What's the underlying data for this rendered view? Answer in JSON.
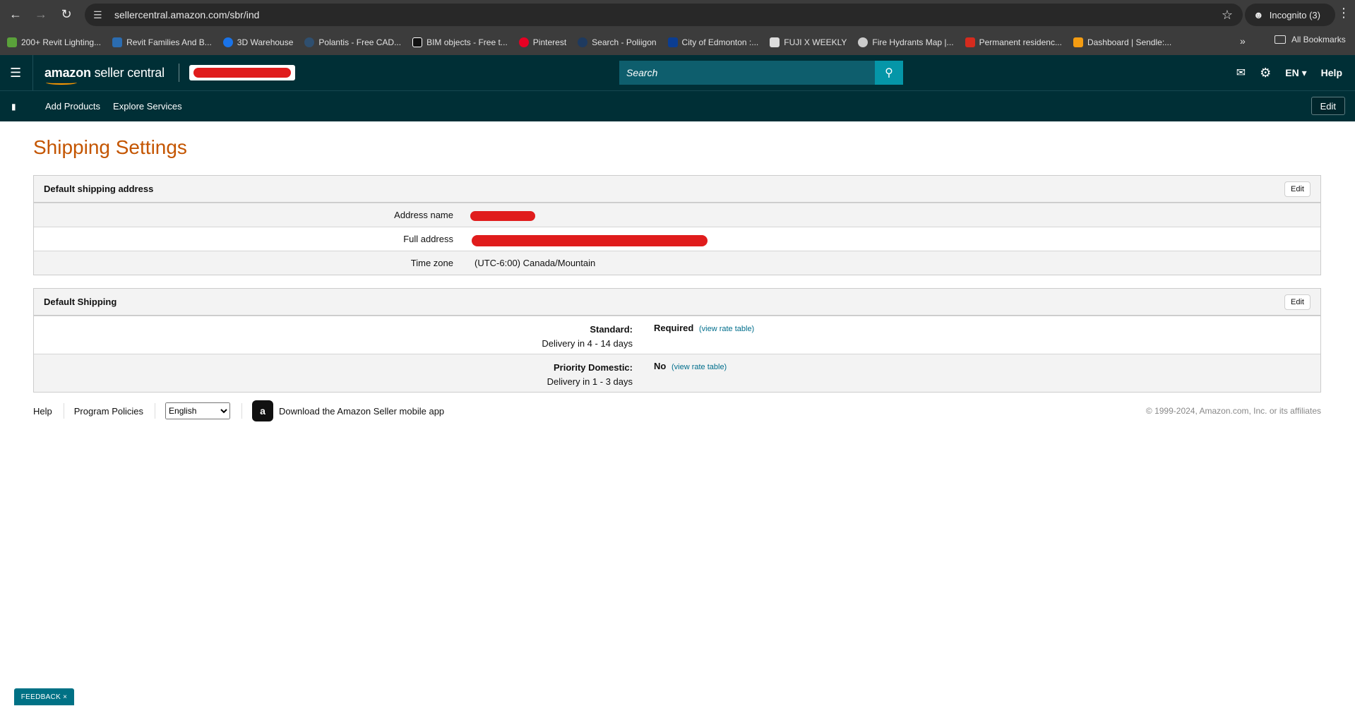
{
  "browser": {
    "url": "sellercentral.amazon.com/sbr/ind",
    "incognito_label": "Incognito (3)",
    "all_bookmarks_label": "All Bookmarks"
  },
  "bookmarks": [
    {
      "label": "200+ Revit Lighting...",
      "color": "#5aa13a"
    },
    {
      "label": "Revit Families And B...",
      "color": "#2b6cb0"
    },
    {
      "label": "3D Warehouse",
      "color": "#1a73e8"
    },
    {
      "label": "Polantis - Free CAD...",
      "color": "#2f4f6f"
    },
    {
      "label": "BIM objects - Free t...",
      "color": "#111111"
    },
    {
      "label": "Pinterest",
      "color": "#e60023"
    },
    {
      "label": "Search - Poliigon",
      "color": "#1e3a5f"
    },
    {
      "label": "City of Edmonton :...",
      "color": "#0b3d91"
    },
    {
      "label": "FUJI X WEEKLY",
      "color": "#dddddd"
    },
    {
      "label": "Fire Hydrants Map |...",
      "color": "#cccccc"
    },
    {
      "label": "Permanent residenc...",
      "color": "#d52b1e"
    },
    {
      "label": "Dashboard | Sendle:...",
      "color": "#f39c12"
    }
  ],
  "header": {
    "logo_bold": "amazon",
    "logo_rest": " seller central",
    "search_placeholder": "Search",
    "lang": "EN",
    "help": "Help"
  },
  "subnav": {
    "links": [
      "Add Products",
      "Explore Services"
    ],
    "edit": "Edit"
  },
  "page": {
    "title": "Shipping Settings"
  },
  "address_panel": {
    "title": "Default shipping address",
    "edit": "Edit",
    "rows": [
      {
        "label": "Address name",
        "value": ""
      },
      {
        "label": "Full address",
        "value": ""
      },
      {
        "label": "Time zone",
        "value": "(UTC-6:00) Canada/Mountain"
      }
    ]
  },
  "shipping_panel": {
    "title": "Default Shipping",
    "edit": "Edit",
    "rows": [
      {
        "name": "Standard:",
        "delivery": "Delivery in 4 - 14 days",
        "status": "Required",
        "link": "(view rate table)"
      },
      {
        "name": "Priority Domestic:",
        "delivery": "Delivery in 1 - 3 days",
        "status": "No",
        "link": "(view rate table)"
      }
    ]
  },
  "footer": {
    "help": "Help",
    "policies": "Program Policies",
    "language": "English",
    "app": "Download the Amazon Seller mobile app",
    "copyright": "© 1999-2024, Amazon.com, Inc. or its affiliates"
  },
  "feedback": "FEEDBACK ×",
  "colors": {
    "header_bg": "#002f36",
    "title": "#c45500",
    "link": "#006e8c",
    "redaction": "#e01c1c"
  }
}
